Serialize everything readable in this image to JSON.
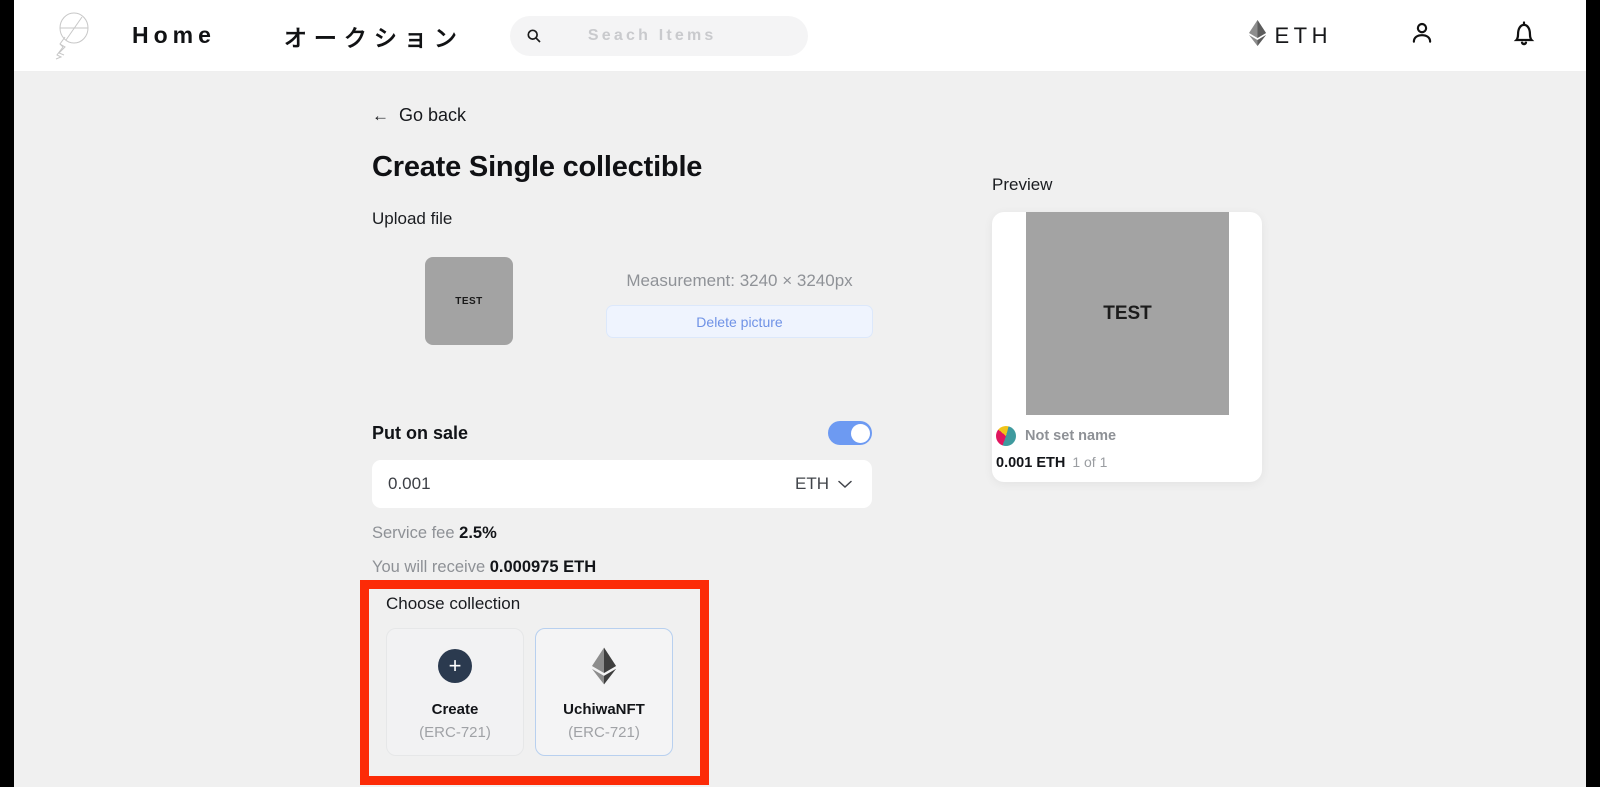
{
  "header": {
    "logo_icon": "uchiwa-fan-logo",
    "nav": [
      {
        "label": "Home"
      },
      {
        "label": "オークション"
      }
    ],
    "search": {
      "icon": "search-icon",
      "placeholder": "Seach Items",
      "value": ""
    },
    "currency_chip": {
      "icon": "ethereum-icon",
      "label": "ETH"
    },
    "account_icon": "person-icon",
    "notifications_icon": "bell-icon"
  },
  "main": {
    "go_back": {
      "icon": "arrow-left-icon",
      "label": "Go back"
    },
    "page_title": "Create Single collectible",
    "upload": {
      "section_label": "Upload file",
      "thumbnail_text": "TEST",
      "measurement": "Measurement: 3240 × 3240px",
      "delete_button": "Delete picture"
    },
    "sale": {
      "title": "Put on sale",
      "toggle_on": true,
      "price_value": "0.001",
      "price_placeholder": "0.001",
      "currency": "ETH",
      "currency_caret_icon": "chevron-down-icon",
      "service_fee_label": "Service fee",
      "service_fee_value": "2.5%",
      "receive_label": "You will receive",
      "receive_value": "0.000975 ETH"
    },
    "collection": {
      "label": "Choose collection",
      "highlighted": true,
      "highlight_color": "#fc2b07",
      "cards": [
        {
          "icon": "plus-circle-icon",
          "name": "Create",
          "standard": "(ERC-721)",
          "selected": false
        },
        {
          "icon": "ethereum-icon",
          "name": "UchiwaNFT",
          "standard": "(ERC-721)",
          "selected": true
        }
      ]
    }
  },
  "preview": {
    "label": "Preview",
    "image_text": "TEST",
    "avatar_icon": "user-avatar-icon",
    "owner_name": "Not set name",
    "price": "0.001 ETH",
    "edition": "1 of 1"
  },
  "colors": {
    "accent_blue": "#6d9af2",
    "highlight_red": "#fc2b07",
    "page_bg": "#f0f0f0",
    "header_bg": "#ffffff",
    "placeholder_gray": "#a3a3a3"
  }
}
